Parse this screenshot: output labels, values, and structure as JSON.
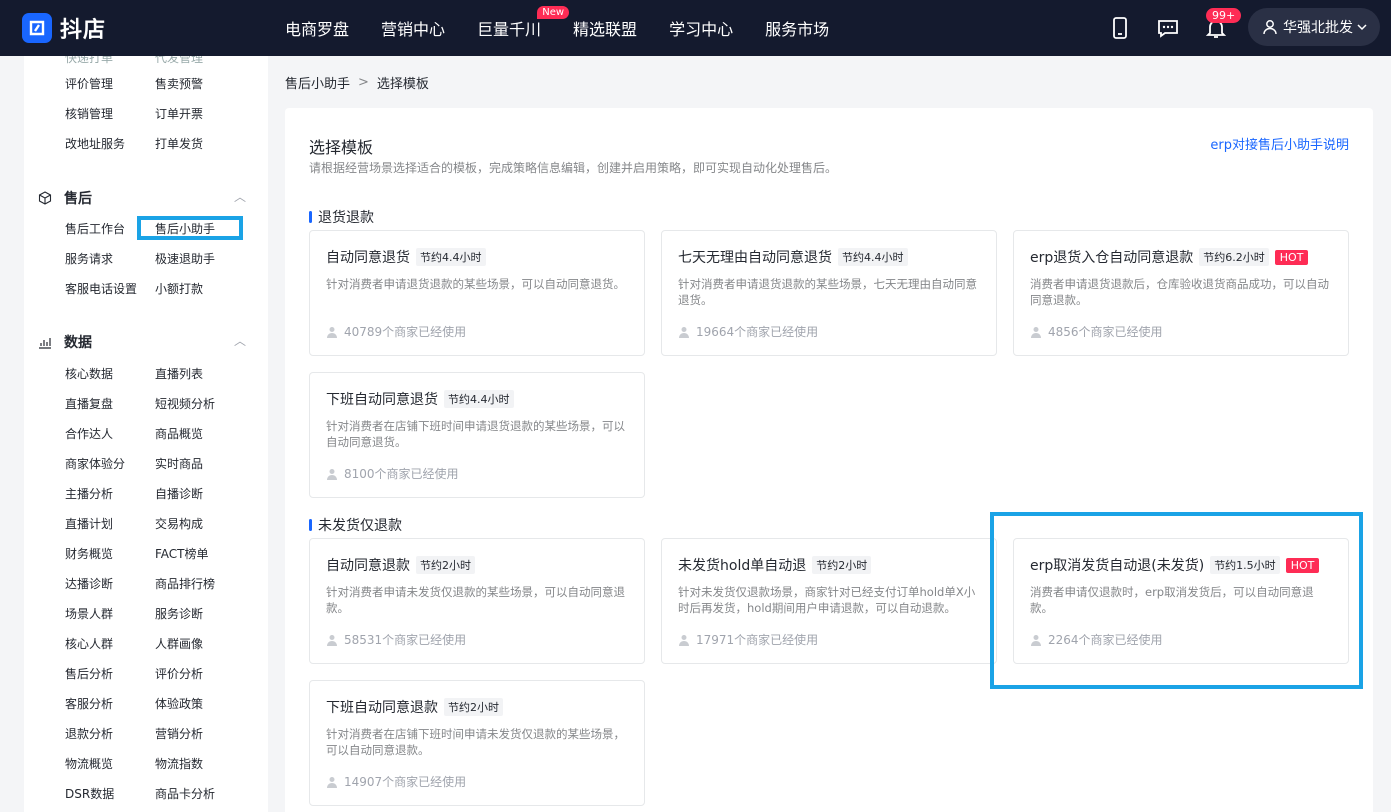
{
  "app": {
    "logo_text": "抖店"
  },
  "nav": {
    "items": [
      "电商罗盘",
      "营销中心",
      "巨量千川",
      "精选联盟",
      "学习中心",
      "服务市场"
    ],
    "new_badge": "New",
    "notification_count": "99+",
    "user_name": "华强北批发"
  },
  "sidebar": {
    "top_rows": [
      [
        "评价管理",
        "售卖预警"
      ],
      [
        "核销管理",
        "订单开票"
      ],
      [
        "改地址服务",
        "打单发货"
      ]
    ],
    "after_sale": {
      "title": "售后",
      "rows": [
        [
          "售后工作台",
          "售后小助手"
        ],
        [
          "服务请求",
          "极速退助手"
        ],
        [
          "客服电话设置",
          "小额打款"
        ]
      ]
    },
    "data": {
      "title": "数据",
      "rows": [
        [
          "核心数据",
          "直播列表"
        ],
        [
          "直播复盘",
          "短视频分析"
        ],
        [
          "合作达人",
          "商品概览"
        ],
        [
          "商家体验分",
          "实时商品"
        ],
        [
          "主播分析",
          "自播诊断"
        ],
        [
          "直播计划",
          "交易构成"
        ],
        [
          "财务概览",
          "FACT榜单"
        ],
        [
          "达播诊断",
          "商品排行榜"
        ],
        [
          "场景人群",
          "服务诊断"
        ],
        [
          "核心人群",
          "人群画像"
        ],
        [
          "售后分析",
          "评价分析"
        ],
        [
          "客服分析",
          "体验政策"
        ],
        [
          "退款分析",
          "营销分析"
        ],
        [
          "物流概览",
          "物流指数"
        ],
        [
          "DSR数据",
          "商品卡分析"
        ]
      ]
    }
  },
  "breadcrumb": {
    "parent": "售后小助手",
    "current": "选择模板"
  },
  "panel": {
    "title": "选择模板",
    "subtitle": "请根据经营场景选择适合的模板，完成策略信息编辑，创建并启用策略，即可实现自动化处理售后。",
    "doc_link": "erp对接售后小助手说明"
  },
  "sections": [
    {
      "title": "退货退款",
      "cards": [
        {
          "title": "自动同意退货",
          "save": "节约4.4小时",
          "hot": "",
          "desc": "针对消费者申请退货退款的某些场景，可以自动同意退货。",
          "usage": "40789个商家已经使用"
        },
        {
          "title": "七天无理由自动同意退货",
          "save": "节约4.4小时",
          "hot": "",
          "desc": "针对消费者申请退货退款的某些场景，七天无理由自动同意退货。",
          "usage": "19664个商家已经使用"
        },
        {
          "title": "erp退货入仓自动同意退款",
          "save": "节约6.2小时",
          "hot": "HOT",
          "desc": "消费者申请退货退款后，仓库验收退货商品成功，可以自动同意退款。",
          "usage": "4856个商家已经使用"
        },
        {
          "title": "下班自动同意退货",
          "save": "节约4.4小时",
          "hot": "",
          "desc": "针对消费者在店铺下班时间申请退货退款的某些场景，可以自动同意退货。",
          "usage": "8100个商家已经使用"
        }
      ]
    },
    {
      "title": "未发货仅退款",
      "cards": [
        {
          "title": "自动同意退款",
          "save": "节约2小时",
          "hot": "",
          "desc": "针对消费者申请未发货仅退款的某些场景，可以自动同意退款。",
          "usage": "58531个商家已经使用"
        },
        {
          "title": "未发货hold单自动退",
          "save": "节约2小时",
          "hot": "",
          "desc": "针对未发货仅退款场景，商家针对已经支付订单hold单X小时后再发货，hold期间用户申请退款，可以自动退款。",
          "usage": "17971个商家已经使用"
        },
        {
          "title": "erp取消发货自动退(未发货)",
          "save": "节约1.5小时",
          "hot": "HOT",
          "desc": "消费者申请仅退款时，erp取消发货后，可以自动同意退款。",
          "usage": "2264个商家已经使用"
        },
        {
          "title": "下班自动同意退款",
          "save": "节约2小时",
          "hot": "",
          "desc": "针对消费者在店铺下班时间申请未发货仅退款的某些场景，可以自动同意退款。",
          "usage": "14907个商家已经使用"
        }
      ]
    }
  ],
  "colors": {
    "nav_bg": "#141a2e",
    "brand_blue": "#1966ff",
    "hot_red": "#fe2c55",
    "highlight": "#1aa3e6"
  }
}
